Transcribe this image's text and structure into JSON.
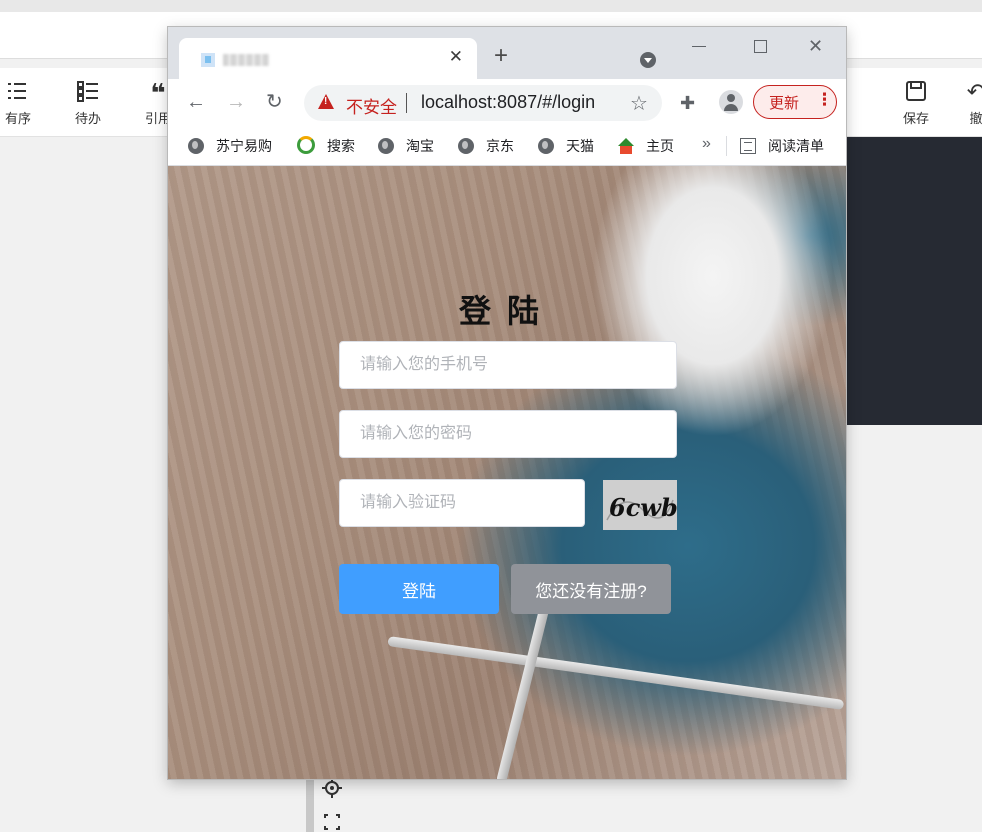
{
  "background_app": {
    "toolbar": [
      {
        "label": "有序",
        "icon": "ordered-list-icon"
      },
      {
        "label": "待办",
        "icon": "todo-list-icon"
      },
      {
        "label": "引用",
        "icon": "quote-icon"
      },
      {
        "label": "保存",
        "icon": "save-icon"
      },
      {
        "label": "撤",
        "icon": "undo-icon"
      }
    ]
  },
  "browser": {
    "tab": {
      "title": "",
      "close_icon": "close-icon"
    },
    "address": {
      "security_label": "不安全",
      "url": "localhost:8087/#/login"
    },
    "update_button": {
      "label": "更新"
    },
    "bookmarks": [
      {
        "label": "苏宁易购",
        "icon": "globe-icon"
      },
      {
        "label": "搜索",
        "icon": "search-ring-icon"
      },
      {
        "label": "淘宝",
        "icon": "globe-icon"
      },
      {
        "label": "京东",
        "icon": "globe-icon"
      },
      {
        "label": "天猫",
        "icon": "globe-icon"
      },
      {
        "label": "主页",
        "icon": "home-2345-icon"
      }
    ],
    "bookmarks_more": "»",
    "reading_list": {
      "label": "阅读清单"
    }
  },
  "login": {
    "title": "登陆",
    "phone_placeholder": "请输入您的手机号",
    "password_placeholder": "请输入您的密码",
    "captcha_placeholder": "请输入验证码",
    "captcha_text": "6cwb",
    "login_button": "登陆",
    "register_button": "您还没有注册?"
  },
  "colors": {
    "primary": "#409eff",
    "secondary": "#909399",
    "insecure": "#c5221f"
  }
}
